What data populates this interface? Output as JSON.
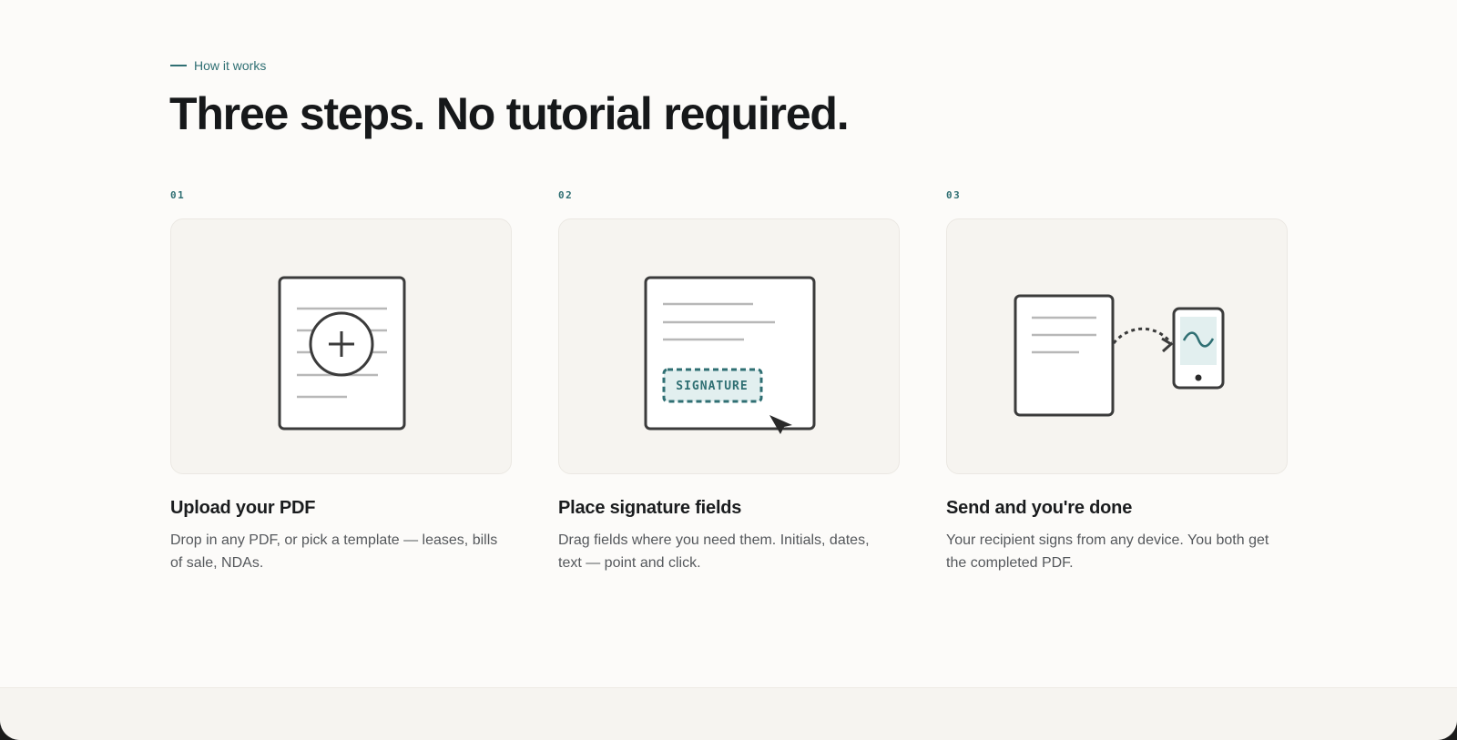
{
  "eyebrow": "How it works",
  "headline": "Three steps. No tutorial required.",
  "steps": [
    {
      "number": "01",
      "title": "Upload your PDF",
      "description": "Drop in any PDF, or pick a template — leases, bills of sale, NDAs.",
      "icon": "document-add-icon"
    },
    {
      "number": "02",
      "title": "Place signature fields",
      "description": "Drag fields where you need them. Initials, dates, text — point and click.",
      "icon": "signature-field-icon",
      "field_label": "SIGNATURE"
    },
    {
      "number": "03",
      "title": "Send and you're done",
      "description": "Your recipient signs from any device. You both get the completed PDF.",
      "icon": "send-to-phone-icon"
    }
  ],
  "colors": {
    "accent": "#2f6f73",
    "accent_tint": "#e2efef",
    "background": "#fcfbf9",
    "card": "#f6f4f0",
    "ink": "#16181a"
  }
}
